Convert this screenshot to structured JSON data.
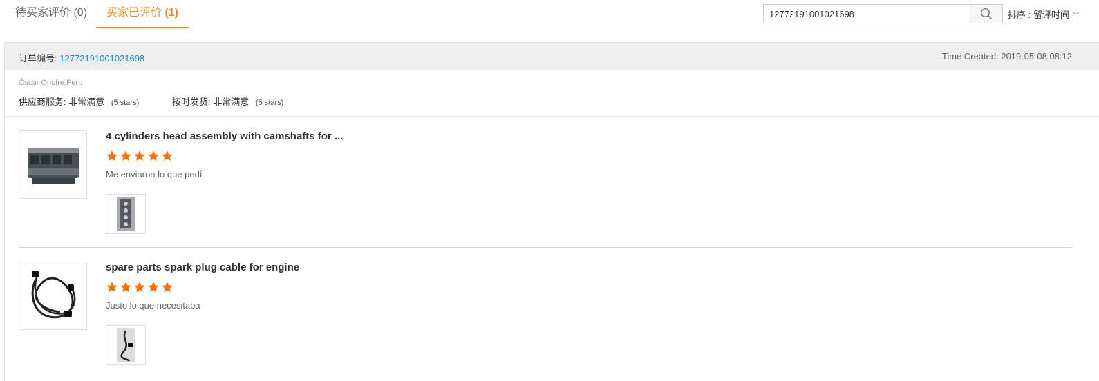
{
  "tabs": [
    {
      "label": "待买家评价",
      "count": "(0)"
    },
    {
      "label": "买家已评价",
      "count": "(1)"
    }
  ],
  "search": {
    "value": "12772191001021698",
    "placeholder": ""
  },
  "sort": {
    "label": "排序 : 留评时间"
  },
  "order": {
    "number_label": "订单编号:",
    "number": "12772191001021698",
    "time_created": "Time Created: 2019-05-08 08:12",
    "buyer": "Óscar Onofre,Peru",
    "ratings": [
      {
        "label": "供应商服务:",
        "value": "非常满意",
        "stars": "(5 stars)"
      },
      {
        "label": "按时发货:",
        "value": "非常满意",
        "stars": "(5 stars)"
      }
    ]
  },
  "items": [
    {
      "title": "4 cylinders head assembly with camshafts for ...",
      "rating": 5,
      "comment": "Me enviaron lo que pedí"
    },
    {
      "title": "spare parts spark plug cable for engine",
      "rating": 5,
      "comment": "Justo lo que necesitaba"
    }
  ],
  "colors": {
    "accent": "#f08a24",
    "link": "#1a8ac8",
    "star": "#f5700a"
  }
}
